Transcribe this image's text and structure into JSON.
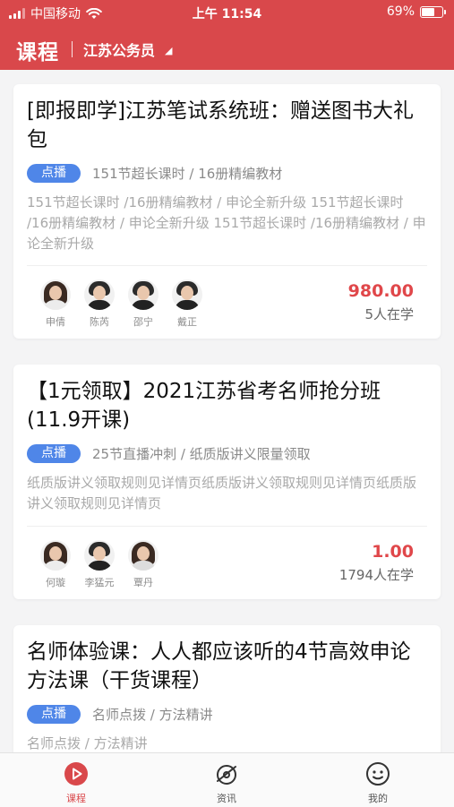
{
  "status_bar": {
    "carrier": "中国移动",
    "time": "上午 11:54",
    "battery": "69%",
    "battery_level": 0.69
  },
  "header": {
    "title": "课程",
    "region": "江苏公务员"
  },
  "courses": [
    {
      "title": "[即报即学]江苏笔试系统班：赠送图书大礼包",
      "tag": "点播",
      "subtitle": "151节超长课时 / 16册精编教材",
      "description": "151节超长课时 /16册精编教材 / 申论全新升级 151节超长课时 /16册精编教材 / 申论全新升级 151节超长课时 /16册精编教材 / 申论全新升级",
      "teachers": [
        "申倩",
        "陈芮",
        "邵宁",
        "戴正"
      ],
      "price": "980.00",
      "learners": "5人在学"
    },
    {
      "title": "【1元领取】2021江苏省考名师抢分班(11.9开课)",
      "tag": "点播",
      "subtitle": "25节直播冲刺 / 纸质版讲义限量领取",
      "description": "纸质版讲义领取规则见详情页纸质版讲义领取规则见详情页纸质版讲义领取规则见详情页",
      "teachers": [
        "何璇",
        "李猛元",
        "覃丹"
      ],
      "price": "1.00",
      "learners": "1794人在学"
    },
    {
      "title": "名师体验课：人人都应该听的4节高效申论方法课（干货课程）",
      "tag": "点播",
      "subtitle": "名师点拨 / 方法精讲",
      "description": "名师点拨 / 方法精讲"
    }
  ],
  "tab_bar": [
    {
      "label": "课程",
      "icon": "play-circle-icon",
      "active": true
    },
    {
      "label": "资讯",
      "icon": "compass-icon",
      "active": false
    },
    {
      "label": "我的",
      "icon": "smiley-icon",
      "active": false
    }
  ],
  "colors": {
    "brand": "#d9484b",
    "tag_blue": "#4f86e8",
    "price_red": "#e0474a"
  }
}
